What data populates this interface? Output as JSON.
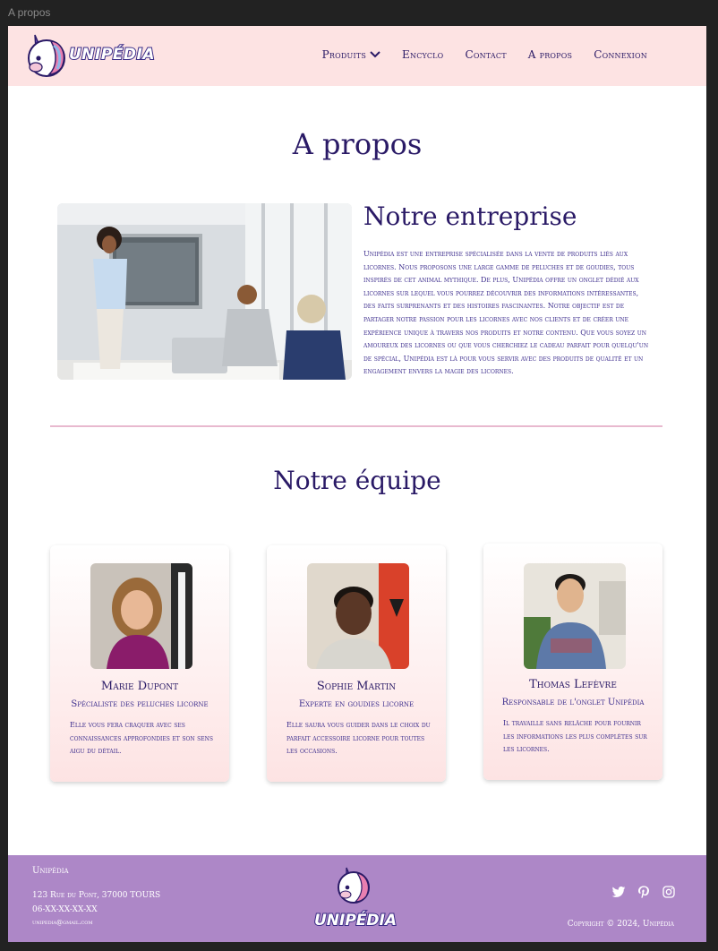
{
  "window": {
    "title": "A propos"
  },
  "brand": {
    "name": "UNIPÉDIA"
  },
  "nav": {
    "items": [
      {
        "label": "Produits"
      },
      {
        "label": "Encyclo"
      },
      {
        "label": "Contact"
      },
      {
        "label": "A propos"
      },
      {
        "label": "Connexion"
      }
    ]
  },
  "page": {
    "title": "A propos"
  },
  "about": {
    "title": "Notre entreprise",
    "text": "Unipédia est une entreprise spécialisée dans la vente de produits liés aux licornes. Nous proposons une large gamme de peluches et de goudies, tous inspirés de cet animal mythique. De plus, Unipédia offre un onglet dédié aux licornes sur lequel vous pourrez découvrir des informations intéressantes, des faits surprenants et des histoires fascinantes. Notre objectif est de partager notre passion pour les licornes avec nos clients et de créer une expérience unique à travers nos produits et notre contenu. Que vous soyez un amoureux des licornes ou que vous cherchiez le cadeau parfait pour quelqu'un de spécial, Unipédia est là pour vous servir avec des produits de qualité et un engagement envers la magie des licornes."
  },
  "team": {
    "title": "Notre équipe",
    "members": [
      {
        "name": "Marie Dupont",
        "role": "Spécialiste des peluches licorne",
        "desc": "Elle vous fera craquer avec ses connaissances approfondies et son sens aigu du détail."
      },
      {
        "name": "Sophie Martin",
        "role": "Experte en goudies licorne",
        "desc": "Elle saura vous guider dans le choix du parfait accessoire licorne pour toutes les occasions."
      },
      {
        "name": "Thomas Lefèvre",
        "role": "Responsable de l'onglet Unipédia",
        "desc": "Il travaille sans relâche pour fournir les informations les plus complètes sur les licornes."
      }
    ]
  },
  "footer": {
    "brand": "Unipédia",
    "address": "123 Rue du Pont, 37000 TOURS",
    "phone": "06-XX-XX-XX-XX",
    "email": "unipedia@gmail.com",
    "copyright": "Copyright © 2024, Unipédia"
  },
  "colors": {
    "header_bg": "#fde3e3",
    "text": "#2a1a66",
    "footer_bg": "#ad87c7",
    "divider": "#e8b9cf"
  },
  "icons": [
    "unicorn-logo",
    "chevron-down-icon",
    "twitter-icon",
    "pinterest-icon",
    "instagram-icon"
  ]
}
